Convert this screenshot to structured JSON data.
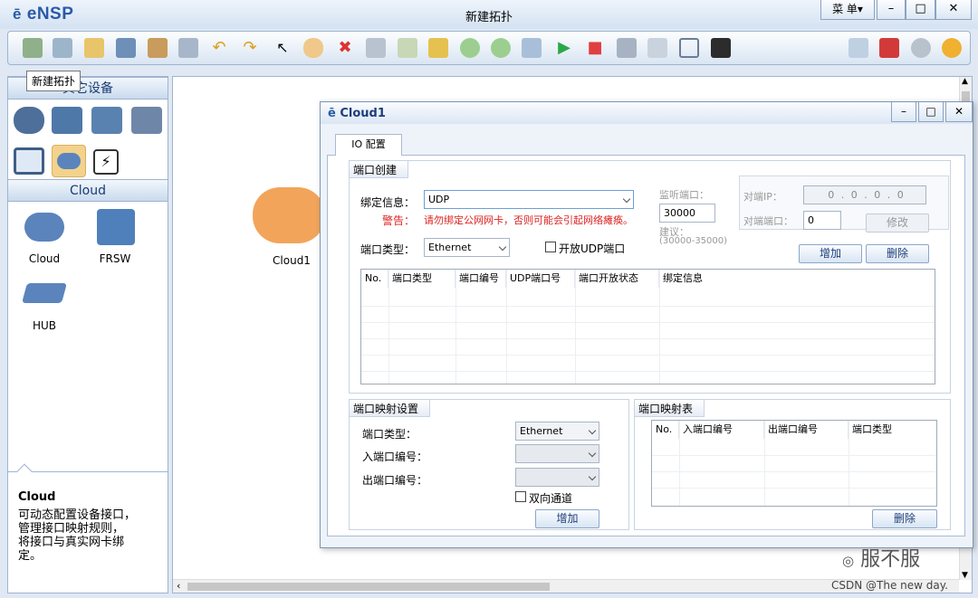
{
  "app": {
    "logo": "eNSP",
    "title": "新建拓扑",
    "menu_label": "菜 单▾",
    "minimize": "–",
    "maximize": "□",
    "close": "✕"
  },
  "tooltip": "新建拓扑",
  "left": {
    "section1": "其它设备",
    "section2": "Cloud",
    "devices": [
      {
        "label": "Cloud"
      },
      {
        "label": "FRSW"
      },
      {
        "label": "HUB"
      }
    ],
    "desc_title": "Cloud",
    "desc_lines": [
      "可动态配置设备接口，",
      "管理接口映射规则，",
      "将接口与真实网卡绑",
      "定。"
    ]
  },
  "canvas": {
    "node_label": "Cloud1"
  },
  "dialog": {
    "title": "Cloud1",
    "tab": "IO 配置",
    "port_create": {
      "group": "端口创建",
      "bind_label": "绑定信息：",
      "bind_value": "UDP",
      "warn_label": "警告：",
      "warn_text": "请勿绑定公网网卡，否则可能会引起网络瘫痪。",
      "port_type_label": "端口类型：",
      "port_type_value": "Ethernet",
      "udp_open": "开放UDP端口",
      "listen_label": "监听端口：",
      "listen_value": "30000",
      "suggest_label": "建议：",
      "suggest_range": "(30000-35000)",
      "peer_ip_label": "对端IP：",
      "peer_ip_value": "0 . 0 . 0 . 0",
      "peer_port_label": "对端端口：",
      "peer_port_value": "0",
      "modify": "修改",
      "add": "增加",
      "delete": "删除",
      "columns": [
        "No.",
        "端口类型",
        "端口编号",
        "UDP端口号",
        "端口开放状态",
        "绑定信息"
      ]
    },
    "map_settings": {
      "group": "端口映射设置",
      "port_type_label": "端口类型：",
      "port_type_value": "Ethernet",
      "in_label": "入端口编号：",
      "out_label": "出端口编号：",
      "bidir": "双向通道",
      "add": "增加"
    },
    "map_table": {
      "group": "端口映射表",
      "columns": [
        "No.",
        "入端口编号",
        "出端口编号",
        "端口类型"
      ],
      "delete": "删除"
    }
  },
  "watermark": {
    "brand": "服不服",
    "credit": "CSDN @The  new  day."
  }
}
